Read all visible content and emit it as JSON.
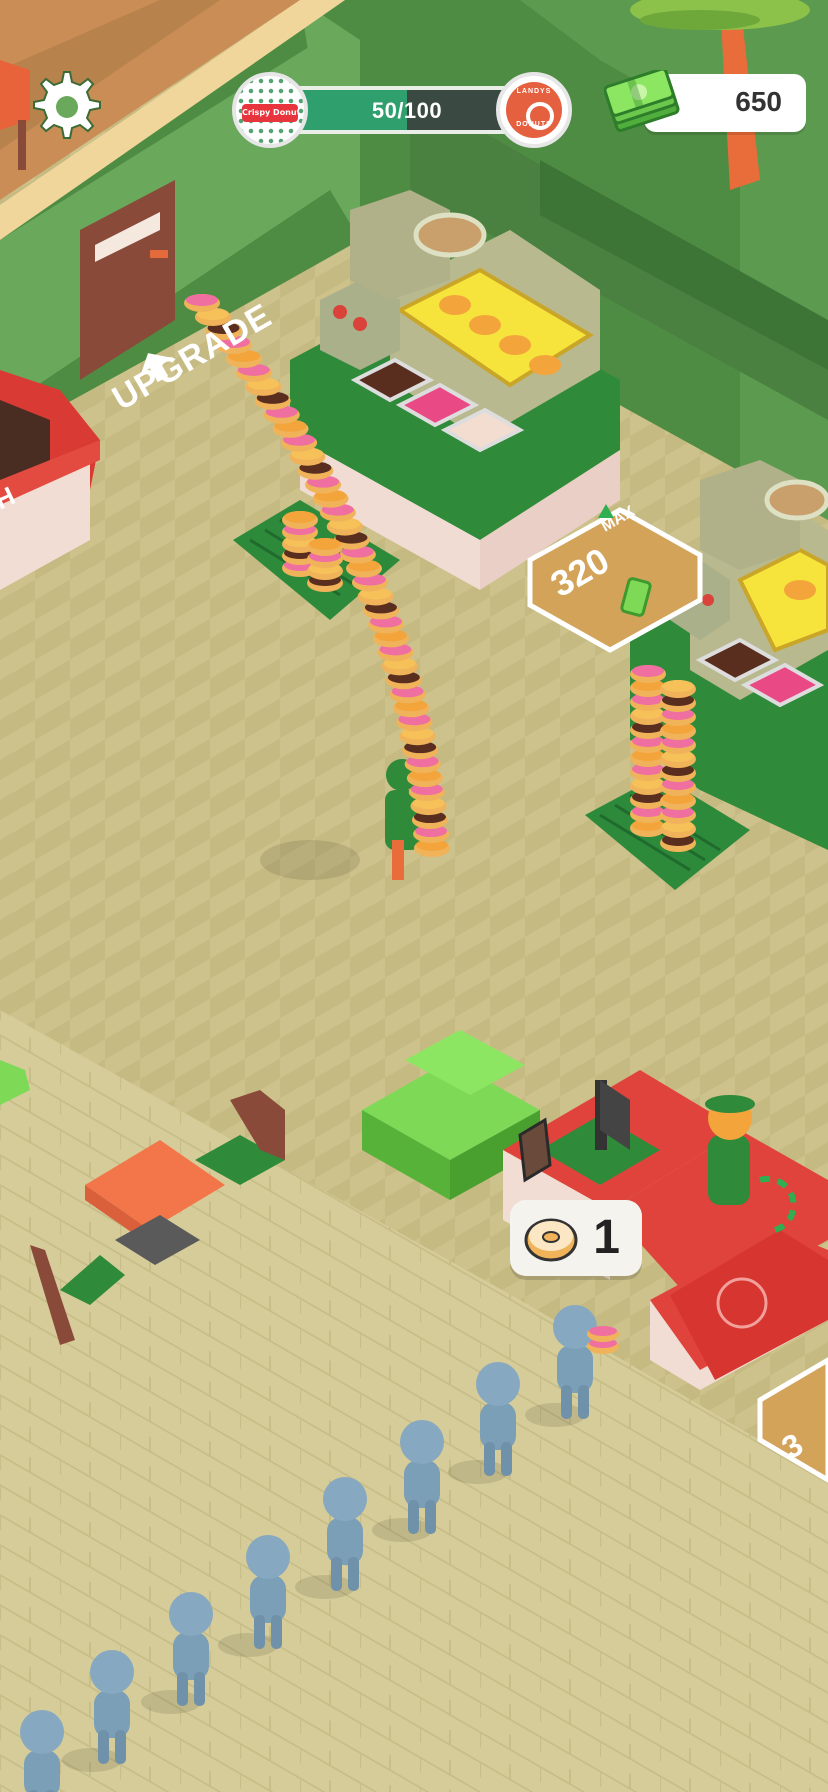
{
  "hud": {
    "progress": {
      "text": "50/100",
      "value": 0.5
    },
    "brand_left": "Crispy Donuts",
    "brand_right_top": "LANDYS",
    "brand_right_bottom": "DONUTS",
    "money": "650"
  },
  "world": {
    "upgrade_label": "UPGRADE",
    "left_booth_label": "H",
    "station_price": "320",
    "station_max": "MAX",
    "bottom_price_fragment": "3"
  },
  "order": {
    "count": "1"
  },
  "icons": {
    "settings": "gear-icon",
    "cash": "cash-stack-icon",
    "donut": "donut-icon",
    "arrow": "up-arrow-icon"
  },
  "colors": {
    "floor": "#cbc089",
    "wall": "#5e9a4d",
    "counter_red": "#e0433c",
    "progress_fill": "#2f9f6d",
    "money_green": "#7ed957"
  }
}
